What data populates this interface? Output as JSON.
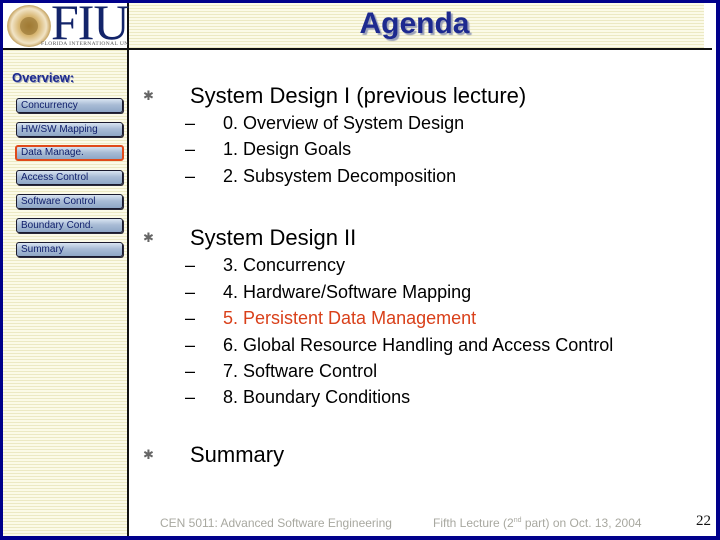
{
  "logo": {
    "text": "FIU",
    "subtitle": "FLORIDA INTERNATIONAL UNIVERSITY"
  },
  "header": {
    "title": "Agenda"
  },
  "sidebar": {
    "heading": "Overview:",
    "items": [
      {
        "label": "Concurrency",
        "active": false
      },
      {
        "label": "HW/SW Mapping",
        "active": false
      },
      {
        "label": "Data Manage.",
        "active": true
      },
      {
        "label": "Access Control",
        "active": false
      },
      {
        "label": "Software Control",
        "active": false
      },
      {
        "label": "Boundary Cond.",
        "active": false
      },
      {
        "label": "Summary",
        "active": false
      }
    ]
  },
  "content": {
    "bullet_icon": "asterisk-bullet-icon",
    "sections": [
      {
        "title": "System Design I (previous lecture)",
        "items": [
          {
            "dash": "–",
            "text": "0. Overview of System Design",
            "highlight": false
          },
          {
            "dash": "–",
            "text": "1. Design Goals",
            "highlight": false
          },
          {
            "dash": "–",
            "text": "2. Subsystem Decomposition",
            "highlight": false
          }
        ]
      },
      {
        "title": "System Design II",
        "items": [
          {
            "dash": "–",
            "text": "3. Concurrency",
            "highlight": false
          },
          {
            "dash": "–",
            "text": "4. Hardware/Software Mapping",
            "highlight": false
          },
          {
            "dash": "–",
            "text": "5. Persistent Data Management",
            "highlight": true
          },
          {
            "dash": "–",
            "text": "6. Global Resource Handling and Access Control",
            "highlight": false
          },
          {
            "dash": "–",
            "text": "7. Software Control",
            "highlight": false
          },
          {
            "dash": "–",
            "text": "8. Boundary Conditions",
            "highlight": false
          }
        ]
      },
      {
        "title": "Summary",
        "items": []
      }
    ]
  },
  "footer": {
    "course": "CEN 5011: Advanced Software Engineering",
    "lecture_prefix": "Fifth Lecture (2",
    "lecture_sup": "nd",
    "lecture_suffix": " part) on Oct. 13, 2004",
    "page_number": "22"
  },
  "colors": {
    "frame": "#00008b",
    "title": "#1d2a8f",
    "highlight": "#d9401a",
    "active_border": "#e04a1a"
  }
}
